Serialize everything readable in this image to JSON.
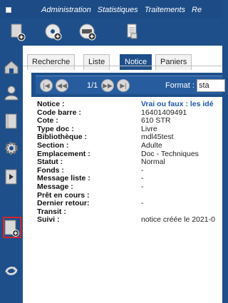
{
  "menu": {
    "items": [
      "Administration",
      "Statistiques",
      "Traitements",
      "Re"
    ]
  },
  "toolbar": {
    "icons": [
      "new-record-icon",
      "disc-add-icon",
      "dvd-add-icon",
      "document-icon"
    ]
  },
  "sidebar": {
    "icons": [
      "home-icon",
      "user-icon",
      "book-icon",
      "gear-icon",
      "arrow-doc-icon",
      "new-record-icon",
      "refresh-icon"
    ]
  },
  "tabs": {
    "recherche": "Recherche",
    "liste": "Liste",
    "notice": "Notice",
    "paniers": "Paniers"
  },
  "nav": {
    "count": "1/1",
    "format_label": "Format :",
    "format_value": "sta"
  },
  "record": [
    {
      "label": "Notice :",
      "value": "Vrai ou faux : les idé"
    },
    {
      "label": "Code barre :",
      "value": "16401409491"
    },
    {
      "label": "Cote :",
      "value": "610 STR"
    },
    {
      "label": "Type doc :",
      "value": "Livre"
    },
    {
      "label": "Bibliothèque :",
      "value": "mdl45test"
    },
    {
      "label": "Section :",
      "value": "Adulte"
    },
    {
      "label": "Emplacement :",
      "value": "Doc - Techniques"
    },
    {
      "label": "Statut :",
      "value": "Normal"
    },
    {
      "label": "Fonds :",
      "value": "-"
    },
    {
      "label": "Message liste :",
      "value": "-"
    },
    {
      "label": "Message :",
      "value": "-"
    },
    {
      "label": "Prêt en cours :",
      "value": ""
    },
    {
      "label": "Dernier retour:",
      "value": "-"
    },
    {
      "label": "Transit :",
      "value": ""
    },
    {
      "label": "Suivi :",
      "value": "notice créée le 2021-0"
    }
  ],
  "colors": {
    "bar": "#1e4f8a",
    "link": "#1f56a8",
    "selection": "#d8242c"
  }
}
